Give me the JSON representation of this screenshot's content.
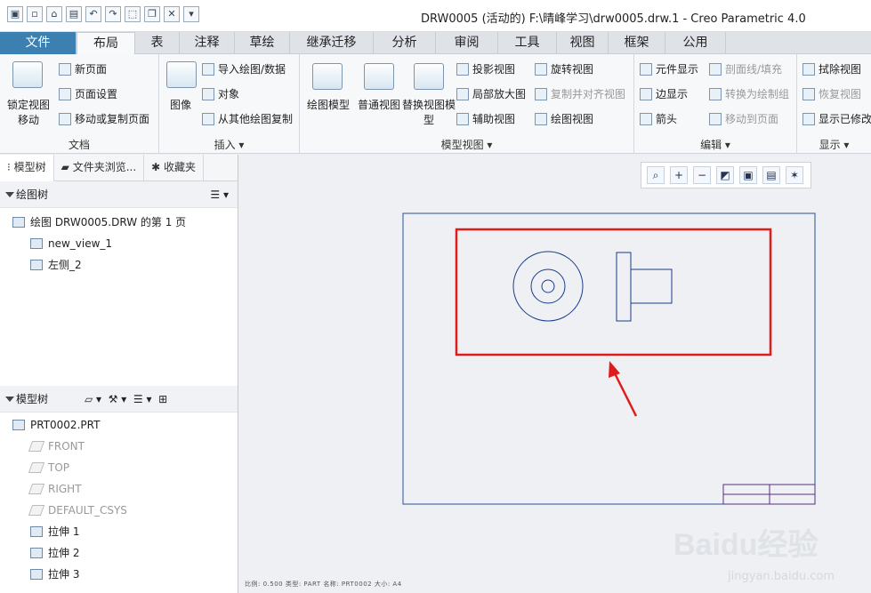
{
  "window": {
    "title": "DRW0005 (活动的) F:\\晴峰学习\\drw0005.drw.1 - Creo Parametric 4.0",
    "quick_access": [
      "app-icon",
      "new-icon",
      "open-icon",
      "save-icon",
      "undo-icon",
      "redo-icon",
      "select-box-icon",
      "window-icon",
      "close-window-icon",
      "more-icon"
    ]
  },
  "tabs": [
    {
      "label": "文件",
      "active": false
    },
    {
      "label": "布局",
      "active": true
    },
    {
      "label": "表",
      "active": false
    },
    {
      "label": "注释",
      "active": false
    },
    {
      "label": "草绘",
      "active": false
    },
    {
      "label": "继承迁移",
      "active": false
    },
    {
      "label": "分析",
      "active": false
    },
    {
      "label": "审阅",
      "active": false
    },
    {
      "label": "工具",
      "active": false
    },
    {
      "label": "视图",
      "active": false
    },
    {
      "label": "框架",
      "active": false
    },
    {
      "label": "公用",
      "active": false
    }
  ],
  "ribbon": {
    "document": {
      "title": "文档",
      "lock_view_move": "锁定视图移动",
      "new_page": "新页面",
      "page_setup": "页面设置",
      "move_copy_page": "移动或复制页面"
    },
    "insert": {
      "title": "插入",
      "image": "图像",
      "import_drawing": "导入绘图/数据",
      "object": "对象",
      "copy_from_other": "从其他绘图复制"
    },
    "model_views": {
      "title": "模型视图",
      "drawing_model": "绘图模型",
      "general_view": "普通视图",
      "replace_view_model": "替换视图模型",
      "projection_view": "投影视图",
      "detail_view": "局部放大图",
      "auxiliary_view": "辅助视图",
      "revolved_view": "旋转视图",
      "copy_align_view": "复制并对齐视图",
      "drawing_view": "绘图视图"
    },
    "edit": {
      "title": "编辑",
      "component_display": "元件显示",
      "edge_display": "边显示",
      "arrow": "箭头",
      "section_line_fill": "剖面线/填充",
      "convert_to_draw_group": "转换为绘制组",
      "move_to_page": "移动到页面"
    },
    "display": {
      "title": "显示",
      "erase_view": "拭除视图",
      "resume_view": "恢复视图",
      "show_modified": "显示已修改"
    }
  },
  "left_panel": {
    "tabs": [
      "模型树",
      "文件夹浏览...",
      "收藏夹"
    ],
    "drawing_tree": {
      "title": "绘图树",
      "items": [
        "绘图 DRW0005.DRW 的第 1 页",
        "new_view_1",
        "左侧_2"
      ]
    },
    "model_tree": {
      "title": "模型树",
      "items": [
        {
          "label": "PRT0002.PRT",
          "dim": false
        },
        {
          "label": "FRONT",
          "dim": true
        },
        {
          "label": "TOP",
          "dim": true
        },
        {
          "label": "RIGHT",
          "dim": true
        },
        {
          "label": "DEFAULT_CSYS",
          "dim": true
        },
        {
          "label": "拉伸 1",
          "dim": false
        },
        {
          "label": "拉伸 2",
          "dim": false
        },
        {
          "label": "拉伸 3",
          "dim": false
        }
      ]
    }
  },
  "graphics": {
    "status_line": "比例: 0.500   类型: PART   名称: PRT0002   大小: A4",
    "highlight_color": "#e01b1b",
    "drawing_line_color": "#1b3c8c"
  },
  "watermark": {
    "brand": "Baidu经验",
    "url": "jingyan.baidu.com"
  }
}
